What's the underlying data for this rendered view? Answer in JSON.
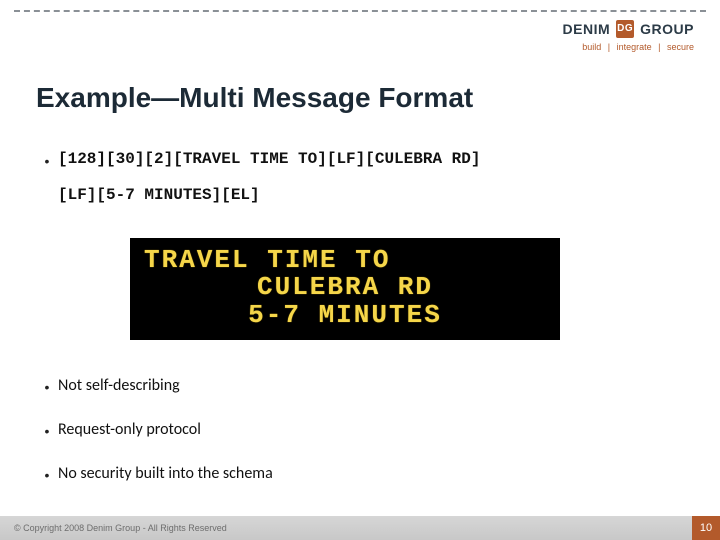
{
  "brand": {
    "name1": "DENIM",
    "logo_text": "DG",
    "name2": "GROUP",
    "tag1": "build",
    "tag2": "integrate",
    "tag3": "secure"
  },
  "title": "Example—Multi Message Format",
  "code": {
    "line1": "[128][30][2][TRAVEL TIME TO][LF][CULEBRA RD]",
    "line2": "[LF][5-7 MINUTES][EL]"
  },
  "sign": {
    "line1": "TRAVEL TIME TO",
    "line2": "CULEBRA RD",
    "line3": "5-7 MINUTES"
  },
  "bullets": {
    "b1": "Not self-describing",
    "b2": "Request-only protocol",
    "b3": "No security built into the schema"
  },
  "footer": {
    "copyright": "© Copyright 2008 Denim Group - All Rights Reserved",
    "page": "10"
  }
}
